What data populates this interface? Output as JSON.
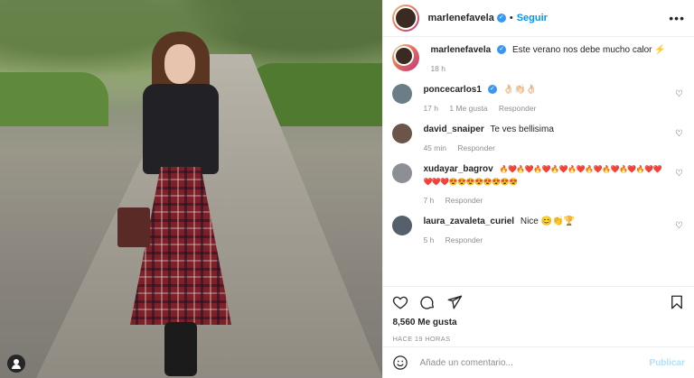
{
  "post": {
    "username": "marlenefavela",
    "follow_label": "Seguir",
    "dot": "•",
    "more_label": "•••"
  },
  "caption": {
    "username": "marlenefavela",
    "text": "Este verano nos debe mucho calor ⚡",
    "time": "18 h"
  },
  "comments": [
    {
      "user": "poncecarlos1",
      "text": "👌🏻👏🏻👌🏻",
      "meta": [
        "17 h",
        "1 Me gusta",
        "Responder"
      ],
      "avatar_color": "#6b7d86"
    },
    {
      "user": "david_snaiper",
      "text": "Te ves bellisima",
      "meta": [
        "45 min",
        "Responder"
      ],
      "avatar_color": "#6a5548"
    },
    {
      "user": "xudayar_bagrov",
      "text": "🔥❤️🔥❤️🔥❤️🔥❤️🔥❤️🔥❤️🔥❤️🔥❤️🔥❤️❤️❤️❤️❤️😍😍😍😍😍😍😍😍",
      "meta": [
        "7 h",
        "Responder"
      ],
      "avatar_color": "#8c8f94"
    },
    {
      "user": "laura_zavaleta_curiel",
      "text": "Nice 😊👏🏆",
      "meta": [
        "5 h",
        "Responder"
      ],
      "avatar_color": "#55606a"
    }
  ],
  "actions": {
    "likes": "8,560 Me gusta",
    "ago": "HACE 19 HORAS"
  },
  "add_comment": {
    "placeholder": "Añade un comentario...",
    "publish_label": "Publicar"
  }
}
